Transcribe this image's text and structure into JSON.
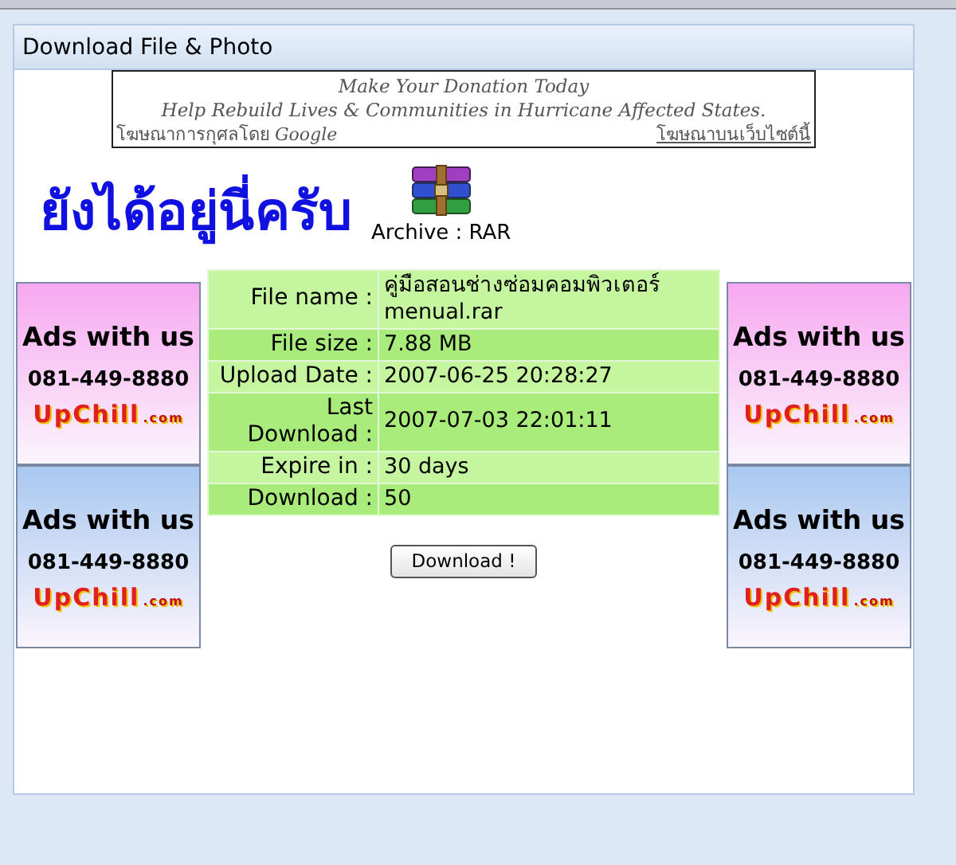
{
  "panel": {
    "title": "Download File & Photo"
  },
  "donation_ad": {
    "line_1": "Make Your Donation Today",
    "line_2": "Help Rebuild Lives & Communities in Hurricane Affected States.",
    "sponsor": "โฆษณาการกุศลโดย",
    "sponsor_brand": "Google",
    "site_link": "โฆษณาบนเว็บไซต์นี้"
  },
  "headline": "ยังได้อยู่นี่ครับ",
  "archive_label": "Archive : RAR",
  "left_banners": [
    {
      "title": "Ads with us",
      "phone": "081-449-8880",
      "logo": "UpChill",
      "logo_suffix": ".com",
      "color": "#f7a8f0"
    },
    {
      "title": "Ads with us",
      "phone": "081-449-8880",
      "logo": "UpChill",
      "logo_suffix": ".com",
      "color": "#a9c8f0"
    }
  ],
  "right_banners": [
    {
      "title": "Ads with us",
      "phone": "081-449-8880",
      "logo": "UpChill",
      "logo_suffix": ".com",
      "color": "#f7a8f0"
    },
    {
      "title": "Ads with us",
      "phone": "081-449-8880",
      "logo": "UpChill",
      "logo_suffix": ".com",
      "color": "#a9c8f0"
    }
  ],
  "file_info": [
    {
      "label": "File name :",
      "value": "คู่มือสอนช่างซ่อมคอมพิวเตอร์ menual.rar"
    },
    {
      "label": "File size :",
      "value": "7.88 MB"
    },
    {
      "label": "Upload Date :",
      "value": "2007-06-25 20:28:27"
    },
    {
      "label": "Last Download :",
      "value": "2007-07-03 22:01:11"
    },
    {
      "label": "Expire in :",
      "value": "30 days"
    },
    {
      "label": "Download :",
      "value": "50"
    }
  ],
  "download_button": "Download !"
}
